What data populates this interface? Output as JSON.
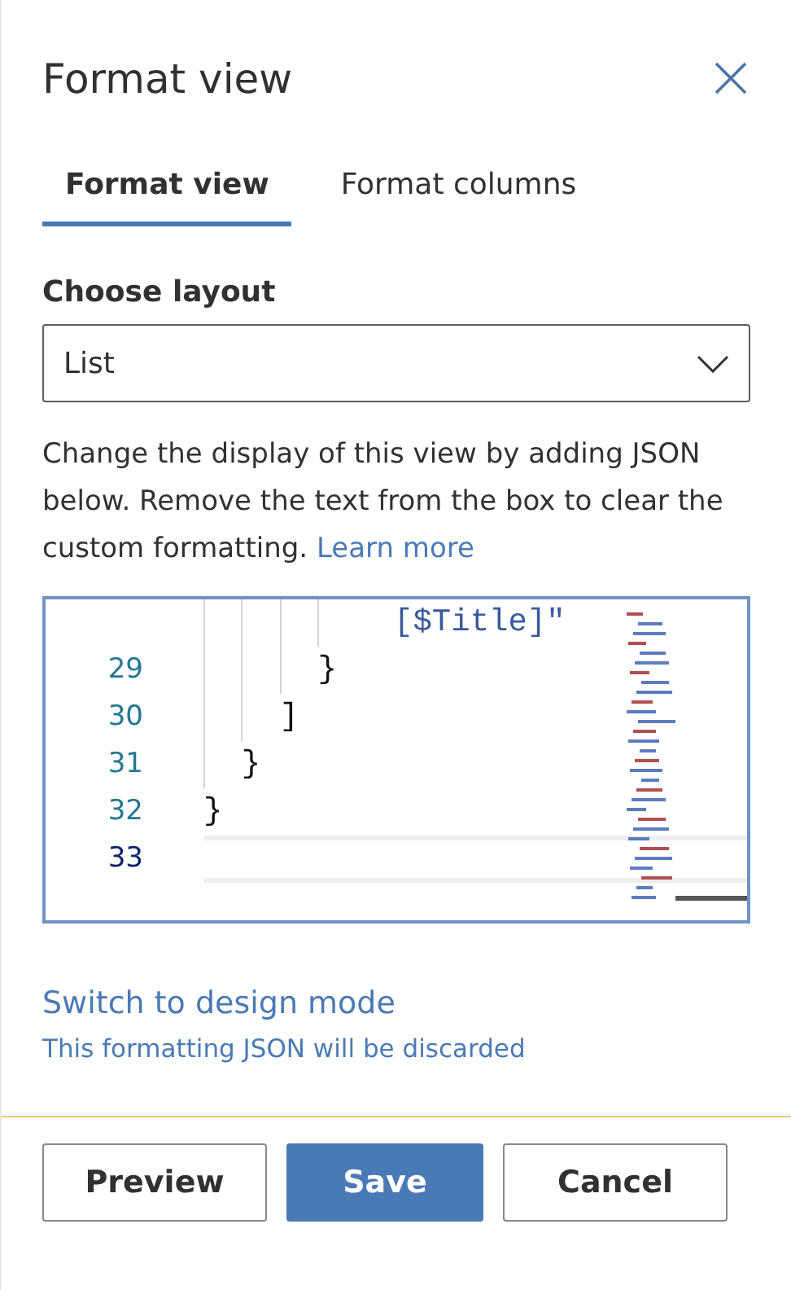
{
  "panel": {
    "title": "Format view"
  },
  "tabs": [
    {
      "label": "Format view",
      "selected": true
    },
    {
      "label": "Format columns",
      "selected": false
    }
  ],
  "layout": {
    "label": "Choose layout",
    "value": "List"
  },
  "description": {
    "text": "Change the display of this view by adding JSON below. Remove the text from the box to clear the custom formatting.",
    "link": "Learn more"
  },
  "editor": {
    "lines": [
      {
        "text": "          [$Title]\"",
        "kind": "string",
        "current": false
      },
      {
        "number": "29",
        "text": "      }",
        "kind": "plain",
        "current": false
      },
      {
        "number": "30",
        "text": "    ]",
        "kind": "plain",
        "current": false
      },
      {
        "number": "31",
        "text": "  }",
        "kind": "plain",
        "current": false
      },
      {
        "number": "32",
        "text": "}",
        "kind": "plain",
        "current": false
      },
      {
        "number": "33",
        "current": true
      }
    ]
  },
  "design_mode": {
    "link": "Switch to design mode",
    "note": "This formatting JSON will be discarded"
  },
  "buttons": [
    {
      "label": "Preview",
      "kind": "secondary"
    },
    {
      "label": "Save",
      "kind": "primary"
    },
    {
      "label": "Cancel",
      "kind": "secondary"
    }
  ]
}
